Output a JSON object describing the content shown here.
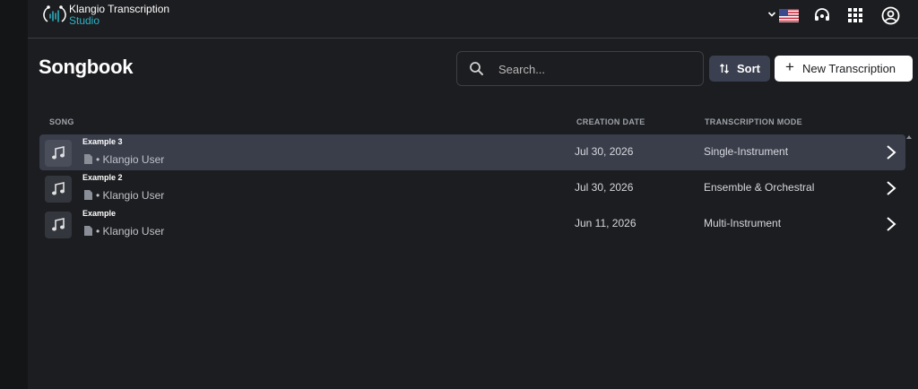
{
  "app": {
    "brand_name": "Klangio Transcription",
    "brand_sub": "Studio"
  },
  "header_icons": [
    "chevron-down-icon",
    "us-flag-icon",
    "support-headset-icon",
    "apps-grid-icon",
    "account-icon"
  ],
  "page": {
    "title": "Songbook"
  },
  "search": {
    "placeholder": "Search..."
  },
  "toolbar": {
    "sort_label": "Sort",
    "new_label": "New Transcription"
  },
  "table": {
    "columns": {
      "song": "SONG",
      "date": "CREATION DATE",
      "mode": "TRANSCRIPTION MODE"
    },
    "rows": [
      {
        "title": "Example 3",
        "owner": "• Klangio User",
        "date": "Jul 30, 2026",
        "mode": "Single-Instrument",
        "selected": true
      },
      {
        "title": "Example 2",
        "owner": "• Klangio User",
        "date": "Jul 30, 2026",
        "mode": "Ensemble & Orchestral",
        "selected": false
      },
      {
        "title": "Example",
        "owner": "• Klangio User",
        "date": "Jun 11, 2026",
        "mode": "Multi-Instrument",
        "selected": false
      }
    ]
  },
  "colors": {
    "background": "#1c1d20",
    "accent": "#2db3c6",
    "row_highlight": "#3a3e4b"
  }
}
